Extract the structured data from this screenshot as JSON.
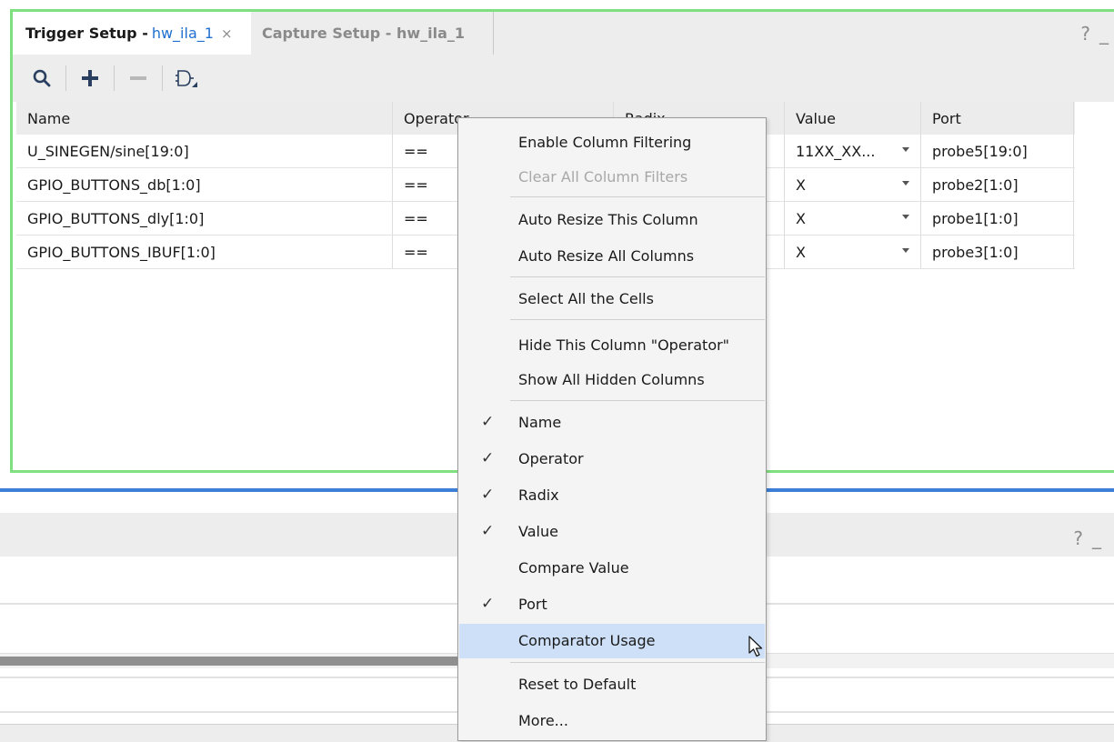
{
  "trigger_tab": {
    "title": "Trigger Setup -",
    "target": "hw_ila_1",
    "close_glyph": "×"
  },
  "capture_tab": {
    "title": "Capture Setup - hw_ila_1"
  },
  "panel_controls": {
    "help": "?",
    "minimize": "_"
  },
  "toolbar": [
    "search-icon",
    "add-icon",
    "remove-icon",
    "logic-gate-icon"
  ],
  "table": {
    "columns": [
      "Name",
      "Operator",
      "Radix",
      "Value",
      "Port"
    ],
    "rows": [
      {
        "name": "U_SINEGEN/sine[19:0]",
        "operator": "==",
        "value": "11XX_XX...",
        "port": "probe5[19:0]"
      },
      {
        "name": "GPIO_BUTTONS_db[1:0]",
        "operator": "==",
        "value": "X",
        "port": "probe2[1:0]"
      },
      {
        "name": "GPIO_BUTTONS_dly[1:0]",
        "operator": "==",
        "value": "X",
        "port": "probe1[1:0]"
      },
      {
        "name": "GPIO_BUTTONS_IBUF[1:0]",
        "operator": "==",
        "value": "X",
        "port": "probe3[1:0]"
      }
    ]
  },
  "bottom_panel": {
    "help": "?",
    "minimize": "_"
  },
  "context_menu": {
    "check_glyph": "✓",
    "items": [
      {
        "label": "Enable Column Filtering",
        "enabled": true
      },
      {
        "label": "Clear All Column Filters",
        "enabled": false
      },
      {
        "label": "Auto Resize This Column",
        "enabled": true
      },
      {
        "label": "Auto Resize All Columns",
        "enabled": true
      },
      {
        "label": "Select All the Cells",
        "enabled": true
      },
      {
        "label": "Hide This Column \"Operator\"",
        "enabled": true
      },
      {
        "label": "Show All Hidden Columns",
        "enabled": true
      },
      {
        "label": "Name",
        "checked": true
      },
      {
        "label": "Operator",
        "checked": true
      },
      {
        "label": "Radix",
        "checked": true
      },
      {
        "label": "Value",
        "checked": true
      },
      {
        "label": "Compare Value",
        "checked": false
      },
      {
        "label": "Port",
        "checked": true
      },
      {
        "label": "Comparator Usage",
        "checked": false,
        "highlighted": true
      },
      {
        "label": "Reset to Default",
        "enabled": true
      },
      {
        "label": "More...",
        "enabled": true
      }
    ]
  },
  "colors": {
    "active_border": "#7fe07f",
    "splitter": "#3d7ed6",
    "link_blue": "#1f6fd0",
    "menu_hover": "#cde0f7"
  }
}
